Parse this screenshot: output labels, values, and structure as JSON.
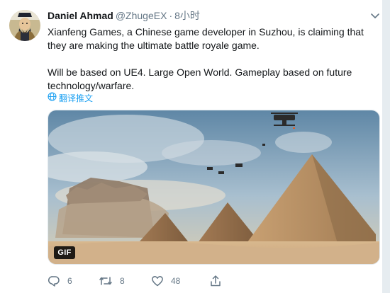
{
  "tweet": {
    "author_name": "Daniel Ahmad",
    "handle": "@ZhugeEX",
    "separator": "·",
    "time": "8小时",
    "paragraph_1": "Xianfeng Games, a Chinese game developer in Suzhou, is claiming that they are making the ultimate battle royale game.",
    "paragraph_2": "Will be based on UE4. Large Open World. Gameplay based on future technology/warfare.",
    "translate_label": "翻译推文"
  },
  "media": {
    "badge": "GIF"
  },
  "actions": {
    "reply_count": "6",
    "retweet_count": "8",
    "like_count": "48"
  },
  "colors": {
    "accent": "#1da1f2",
    "secondary_text": "#657786"
  },
  "icons": [
    "caret-down-icon",
    "globe-icon",
    "reply-icon",
    "retweet-icon",
    "like-icon",
    "share-icon"
  ]
}
